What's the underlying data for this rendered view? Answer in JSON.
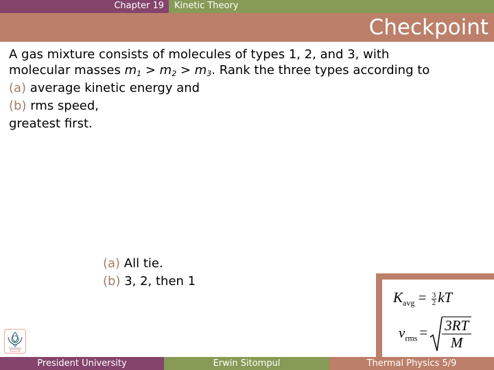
{
  "header": {
    "chapter": "Chapter 19",
    "topic": "Kinetic Theory"
  },
  "title": "Checkpoint",
  "question": {
    "line1": "A gas mixture consists of molecules of types 1, 2, and 3, with",
    "line2_prefix": "molecular masses ",
    "m": "m",
    "sub1": "1",
    "sub2": "2",
    "sub3": "3",
    "gt": " > ",
    "line2_suffix": ". Rank the three types according to",
    "part_a_label": "(a)",
    "part_a_text": " average kinetic energy and",
    "part_b_label": "(b)",
    "part_b_text": " rms speed,",
    "closing": "greatest first."
  },
  "answers": {
    "a_label": "(a)",
    "a_text": " All tie.",
    "b_label": "(b)",
    "b_text": " 3, 2, then 1"
  },
  "formulas": {
    "k_symbol": "K",
    "k_sub": "avg",
    "equals": "=",
    "frac_num": "3",
    "frac_den": "2",
    "k_rhs": "kT",
    "v_symbol": "v",
    "v_sub": "rms",
    "sqrt_num": "3RT",
    "sqrt_den": "M"
  },
  "footer": {
    "institution": "President University",
    "author": "Erwin Sitompul",
    "course_page": "Thermal Physics 5/9"
  },
  "colors": {
    "purple": "#84446c",
    "green": "#879a56",
    "rust": "#bc7f6a",
    "accent_text": "#a07c6c"
  }
}
